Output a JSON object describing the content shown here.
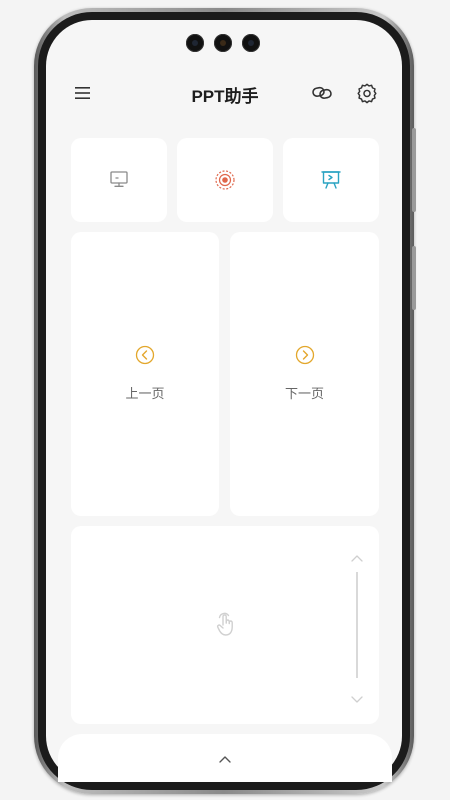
{
  "header": {
    "title": "PPT助手",
    "menu_icon": "hamburger-menu-icon",
    "link_icon": "link-icon",
    "settings_icon": "gear-icon"
  },
  "modes": [
    {
      "icon": "monitor-icon",
      "color": "#8a8a8a"
    },
    {
      "icon": "laser-pointer-icon",
      "color": "#e0674b"
    },
    {
      "icon": "presentation-play-icon",
      "color": "#2aa3c2"
    }
  ],
  "navigation": {
    "prev_label": "上一页",
    "next_label": "下一页",
    "accent_color": "#e3a72c"
  },
  "touchpad": {
    "gesture_icon": "tap-hand-icon",
    "scroll_up_icon": "chevron-up-icon",
    "scroll_down_icon": "chevron-down-icon"
  },
  "bottom_bar": {
    "expand_icon": "chevron-up-icon"
  }
}
